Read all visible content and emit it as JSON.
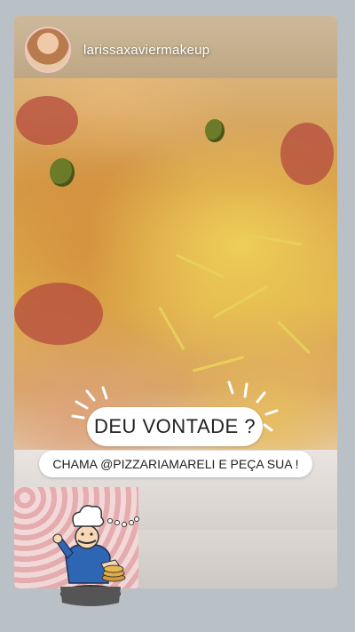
{
  "story": {
    "username": "larissaxaviermakeup",
    "sticker_main": "DEU VONTADE ?",
    "sticker_sub": "CHAMA @PIZZARIAMARELI E PEÇA SUA !"
  },
  "icons": {
    "avatar": "profile-avatar",
    "chef": "chef-mascot-icon",
    "rays": "sparkle-rays-icon"
  },
  "colors": {
    "background": "#b9c0c6",
    "sticker": "#ffffff",
    "text": "#222222"
  }
}
